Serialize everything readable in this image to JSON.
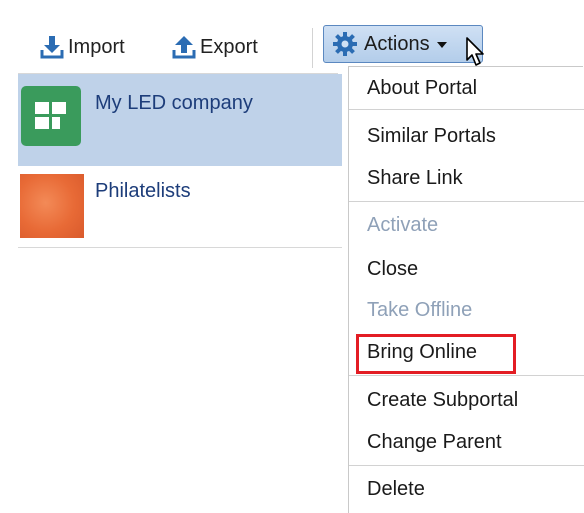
{
  "toolbar": {
    "import_label": "Import",
    "export_label": "Export",
    "actions_label": "Actions"
  },
  "portals": [
    {
      "name": "My LED company",
      "selected": true
    },
    {
      "name": "Philatelists",
      "selected": false
    }
  ],
  "menu": {
    "about": "About Portal",
    "similar": "Similar Portals",
    "share": "Share Link",
    "activate": "Activate",
    "close": "Close",
    "take_offline": "Take Offline",
    "bring_online": "Bring Online",
    "create_subportal": "Create Subportal",
    "change_parent": "Change Parent",
    "delete": "Delete"
  },
  "disabled_items": [
    "Activate",
    "Take Offline"
  ],
  "highlighted_item": "Bring Online",
  "icons": {
    "import": "download-icon",
    "export": "upload-icon",
    "actions": "gear-icon",
    "dropdown": "caret-down-icon",
    "cursor": "mouse-pointer-icon"
  },
  "colors": {
    "accent_blue": "#2b6cb3",
    "selected_row": "#bfd2e9",
    "highlight": "#e31d24",
    "disabled_text": "#8fa1b8"
  }
}
